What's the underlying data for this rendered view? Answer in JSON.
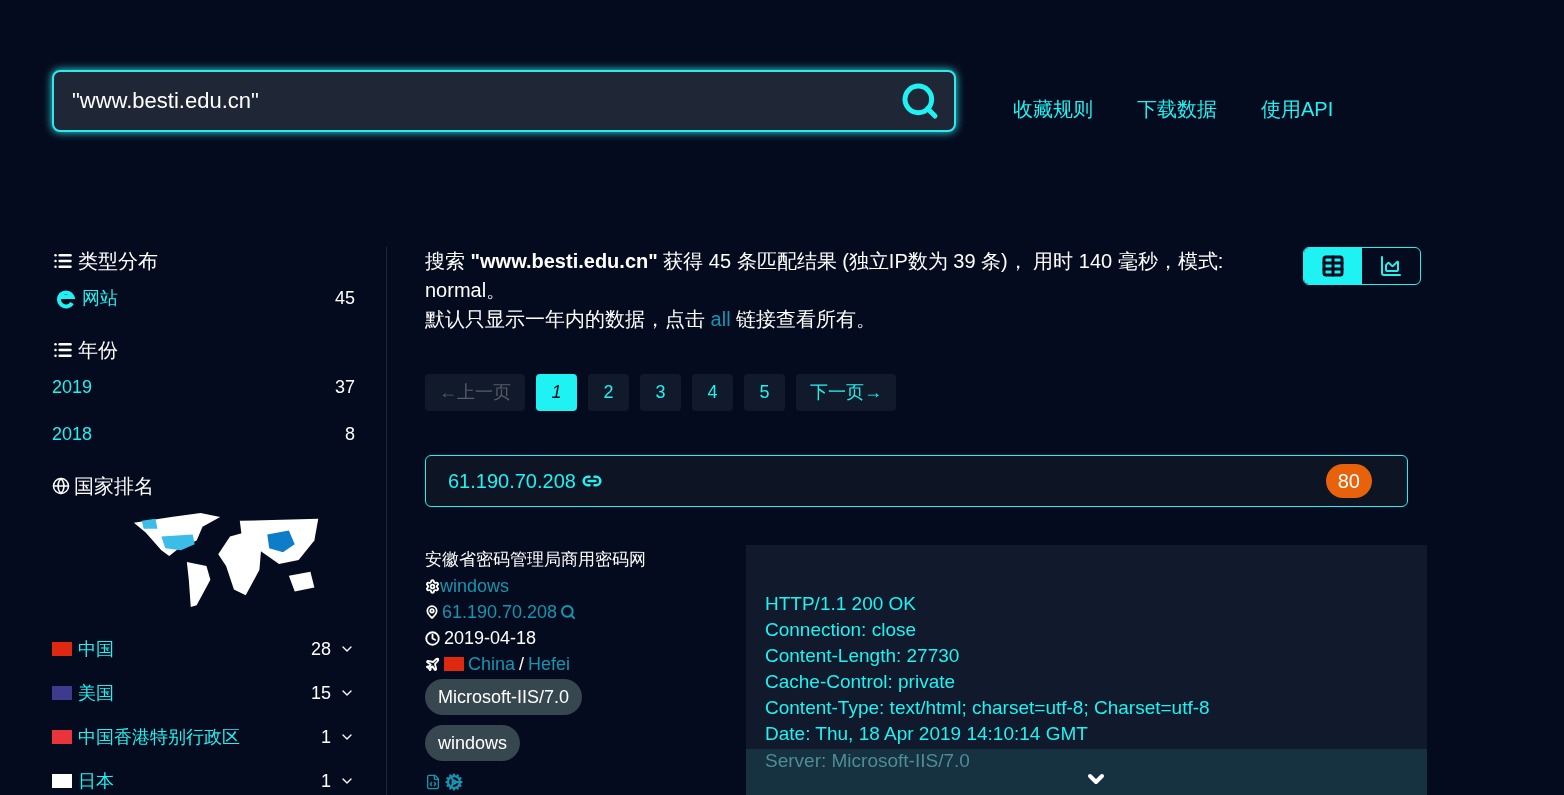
{
  "search": {
    "value": "\"www.besti.edu.cn\""
  },
  "nav_links": [
    "收藏规则",
    "下载数据",
    "使用API"
  ],
  "sidebar": [
    {
      "title": "类型分布",
      "kind": "list",
      "items": [
        {
          "kind": "type",
          "label": "网站",
          "count": "45"
        }
      ]
    },
    {
      "title": "年份",
      "kind": "list",
      "items": [
        {
          "kind": "year",
          "label": "2019",
          "count": "37"
        },
        {
          "kind": "year",
          "label": "2018",
          "count": "8"
        }
      ]
    },
    {
      "title": "国家排名",
      "kind": "globe",
      "items": [
        {
          "kind": "country",
          "color": "#de2910",
          "label": "中国",
          "count": "28",
          "expanded": false
        },
        {
          "kind": "country",
          "color": "#3c3b8e",
          "label": "美国",
          "count": "15",
          "expanded": false
        },
        {
          "kind": "country",
          "color": "#e8343a",
          "label": "中国香港特别行政区",
          "count": "1",
          "expanded": false
        },
        {
          "kind": "country",
          "color": "#ffffff",
          "label": "日本",
          "count": "1",
          "expanded": false
        }
      ]
    }
  ],
  "summary": {
    "text": "搜索 **\"www.besti.edu.cn\"** 获得 45 条匹配结果 (独立IP数为 39 条)， 用时 140 毫秒，模式: normal。",
    "note_before": "默认只显示一年内的数据，点击",
    "note_link": "all",
    "note_after": "链接查看所有。"
  },
  "view_toggle": [
    {
      "kind": "list",
      "selected": true
    },
    {
      "kind": "chart",
      "selected": false
    }
  ],
  "pagination": {
    "prev": {
      "label": "←上一页",
      "disabled": true
    },
    "pages": [
      {
        "label": "1",
        "selected": true
      },
      {
        "label": "2",
        "selected": false
      },
      {
        "label": "3",
        "selected": false
      },
      {
        "label": "4",
        "selected": false
      },
      {
        "label": "5",
        "selected": false
      }
    ],
    "next": {
      "label": "下一页→",
      "disabled": false
    }
  },
  "result": {
    "ip": "61.190.70.208",
    "port": "80",
    "title": "安徽省密码管理局商用密码网",
    "os": "windows",
    "ip_link": "61.190.70.208",
    "date": "2019-04-18",
    "country": "China",
    "separator": "/",
    "city": "Hefei",
    "tags": [
      "Microsoft-IIS/7.0",
      "windows"
    ],
    "header": {
      "collapsed": true,
      "lines": [
        "HTTP/1.1 200 OK",
        "Connection: close",
        "Content-Length: 27730",
        "Cache-Control: private",
        "Content-Type: text/html; charset=utf-8; Charset=utf-8",
        "Date: Thu, 18 Apr 2019 14:10:14 GMT",
        "Server: Microsoft-IIS/7.0"
      ]
    }
  }
}
